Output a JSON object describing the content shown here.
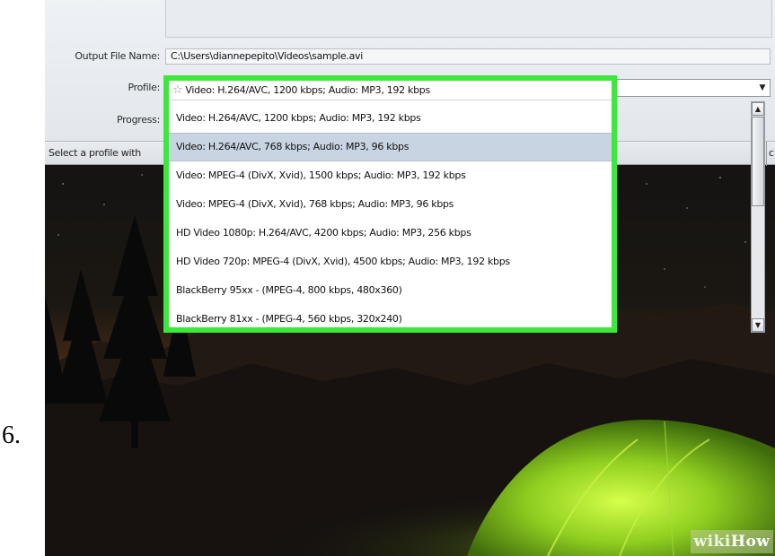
{
  "step": {
    "number": "6."
  },
  "dialog": {
    "output_label": "Output File Name:",
    "output_value": "C:\\Users\\diannepepito\\Videos\\sample.avi",
    "profile_label": "Profile:",
    "progress_label": "Progress:",
    "status_text": "Select a profile with",
    "status_edge": "c"
  },
  "profile": {
    "selected": "Video: H.264/AVC, 1200 kbps; Audio: MP3, 192 kbps",
    "options": [
      "Video: H.264/AVC, 1200 kbps; Audio: MP3, 192 kbps",
      "Video: H.264/AVC, 768 kbps; Audio: MP3, 96 kbps",
      "Video: MPEG-4 (DivX, Xvid), 1500 kbps; Audio: MP3, 192 kbps",
      "Video: MPEG-4 (DivX, Xvid), 768 kbps; Audio: MP3, 96 kbps",
      "HD Video 1080p: H.264/AVC, 4200 kbps; Audio: MP3, 256 kbps",
      "HD Video 720p: MPEG-4 (DivX, Xvid), 4500 kbps; Audio: MP3, 192 kbps",
      "BlackBerry 95xx - (MPEG-4, 800 kbps, 480x360)",
      "BlackBerry 81xx - (MPEG-4, 560 kbps, 320x240)"
    ],
    "hovered_index": 1,
    "highlight_color": "#3ce83c"
  },
  "watermark": {
    "wiki": "wiki",
    "how": "How"
  }
}
